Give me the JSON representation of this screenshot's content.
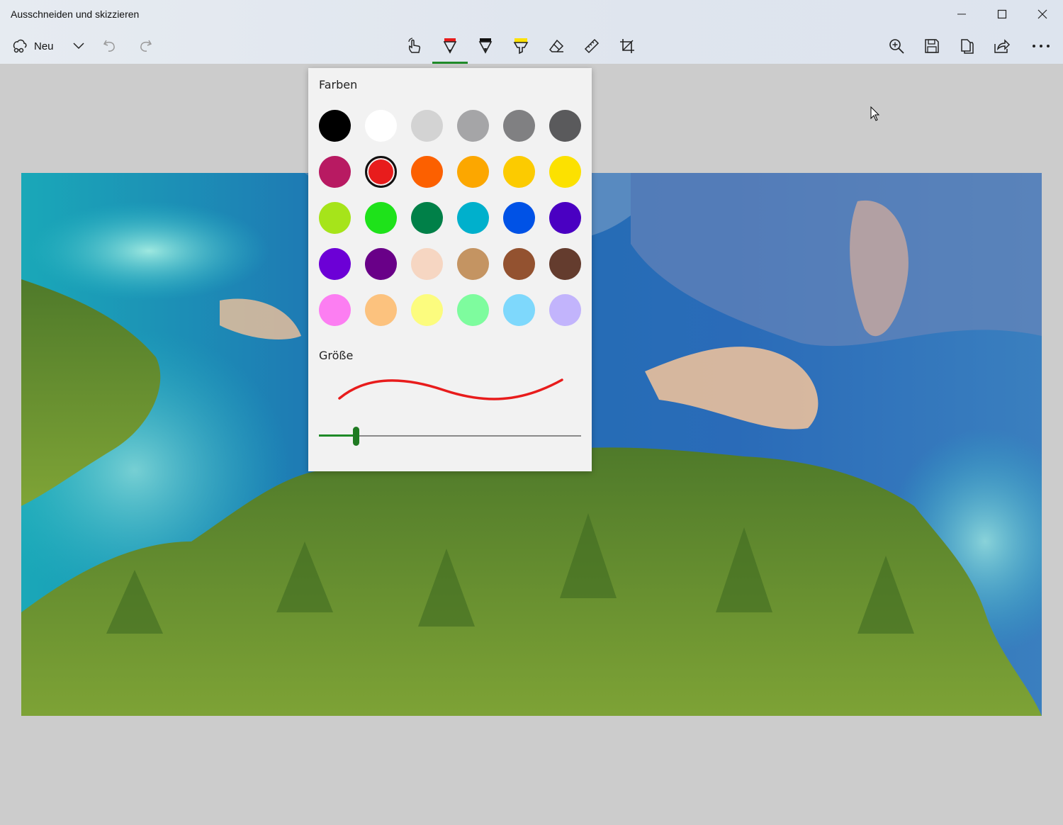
{
  "window": {
    "title": "Ausschneiden und skizzieren",
    "controls": [
      "minimize-icon",
      "maximize-icon",
      "close-icon"
    ]
  },
  "toolbar": {
    "new_label": "Neu",
    "left_icons": [
      "new-snip-icon",
      "chevron-down-icon",
      "undo-icon",
      "redo-icon"
    ],
    "tools": [
      "touch-writing-icon",
      "ballpoint-pen-icon",
      "pencil-icon",
      "highlighter-icon",
      "eraser-icon",
      "ruler-icon",
      "crop-icon"
    ],
    "active_tool": "ballpoint-pen-icon",
    "active_color": "#1f8a28",
    "right_icons": [
      "zoom-in-icon",
      "save-icon",
      "copy-icon",
      "share-icon",
      "more-icon"
    ]
  },
  "pen_popup": {
    "colors_label": "Farben",
    "size_label": "Größe",
    "selected_color": "#e81c1c",
    "colors": [
      "#000000",
      "#ffffff",
      "#d3d3d3",
      "#a5a5a7",
      "#808082",
      "#5a5a5c",
      "#b81a62",
      "#e81c1c",
      "#fc6000",
      "#fca700",
      "#fccb00",
      "#fce100",
      "#a6e41a",
      "#1ee21a",
      "#008048",
      "#00b0cc",
      "#0052e6",
      "#4a00c2",
      "#6c00d6",
      "#690088",
      "#f6d6c2",
      "#c49462",
      "#935230",
      "#643c2e",
      "#fc7ef2",
      "#fcc27e",
      "#fcfc7e",
      "#7efc9e",
      "#7ed8fc",
      "#c2b4fc"
    ],
    "size_fraction": 0.14
  }
}
